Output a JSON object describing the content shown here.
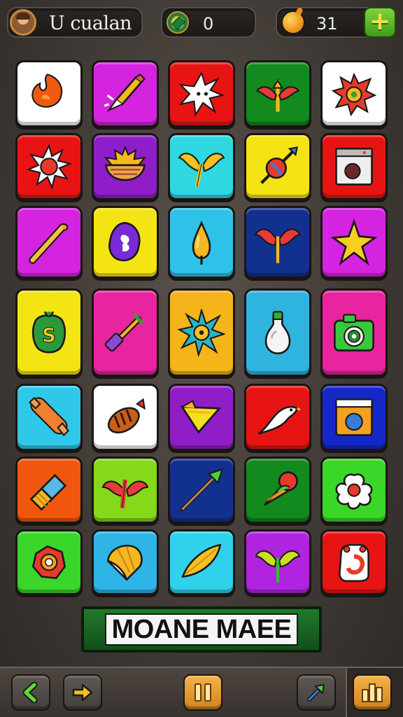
{
  "header": {
    "player_name": "U cualan",
    "gems": "0",
    "coins": "31",
    "icons": {
      "avatar": "player-avatar",
      "gems": "compass-gem-icon",
      "coins": "coin-bag-icon",
      "add": "plus-icon"
    }
  },
  "board": {
    "rows": 7,
    "cols": 5,
    "tiles": [
      {
        "color": "#ffffff",
        "icon": "fire-drop"
      },
      {
        "color": "#d524e0",
        "icon": "golden-dagger"
      },
      {
        "color": "#e81414",
        "icon": "spiky-star"
      },
      {
        "color": "#128a1e",
        "icon": "winged-arrow"
      },
      {
        "color": "#ffffff",
        "icon": "red-gear"
      },
      {
        "color": "#e81414",
        "icon": "spiked-sun"
      },
      {
        "color": "#8f1ec8",
        "icon": "sun-bowl"
      },
      {
        "color": "#2fd8e0",
        "icon": "golden-wings"
      },
      {
        "color": "#f5e414",
        "icon": "globe-spear"
      },
      {
        "color": "#e81414",
        "icon": "washer-box"
      },
      {
        "color": "#d524e0",
        "icon": "golden-rod"
      },
      {
        "color": "#f5e414",
        "icon": "purple-blob"
      },
      {
        "color": "#2fc2e8",
        "icon": "golden-drop"
      },
      {
        "color": "#12318e",
        "icon": "red-wings"
      },
      {
        "color": "#d524e0",
        "icon": "gold-star"
      },
      {
        "color": "#f5e414",
        "icon": "green-gem"
      },
      {
        "color": "#e8249e",
        "icon": "mallet"
      },
      {
        "color": "#f5b41a",
        "icon": "teal-sun"
      },
      {
        "color": "#2fb4e0",
        "icon": "white-bottle"
      },
      {
        "color": "#e8249e",
        "icon": "camera"
      },
      {
        "color": "#2fc8e8",
        "icon": "candy-roll"
      },
      {
        "color": "#ffffff",
        "icon": "striped-candy"
      },
      {
        "color": "#8f1ec8",
        "icon": "yellow-cone"
      },
      {
        "color": "#e81414",
        "icon": "white-bird"
      },
      {
        "color": "#1428c8",
        "icon": "orange-washer"
      },
      {
        "color": "#f0560e",
        "icon": "blue-crystal"
      },
      {
        "color": "#86d81a",
        "icon": "red-phoenix"
      },
      {
        "color": "#12318e",
        "icon": "green-spear"
      },
      {
        "color": "#128a1e",
        "icon": "ice-cream"
      },
      {
        "color": "#3ad62a",
        "icon": "white-flower"
      },
      {
        "color": "#3ad62a",
        "icon": "red-ring"
      },
      {
        "color": "#2fb4e8",
        "icon": "shell"
      },
      {
        "color": "#2fd2ea",
        "icon": "golden-leaf"
      },
      {
        "color": "#b024e0",
        "icon": "green-wings"
      },
      {
        "color": "#e81414",
        "icon": "red-bag"
      }
    ]
  },
  "banner": {
    "title": "MOANE MAEE"
  },
  "footer": {
    "buttons": [
      {
        "name": "back-button",
        "icon": "left-arrow-icon"
      },
      {
        "name": "next-button",
        "icon": "right-arrow-icon"
      },
      {
        "name": "pause-button",
        "icon": "pause-icon"
      },
      {
        "name": "hint-button",
        "icon": "wand-icon"
      },
      {
        "name": "stats-button",
        "icon": "bars-icon"
      }
    ]
  }
}
